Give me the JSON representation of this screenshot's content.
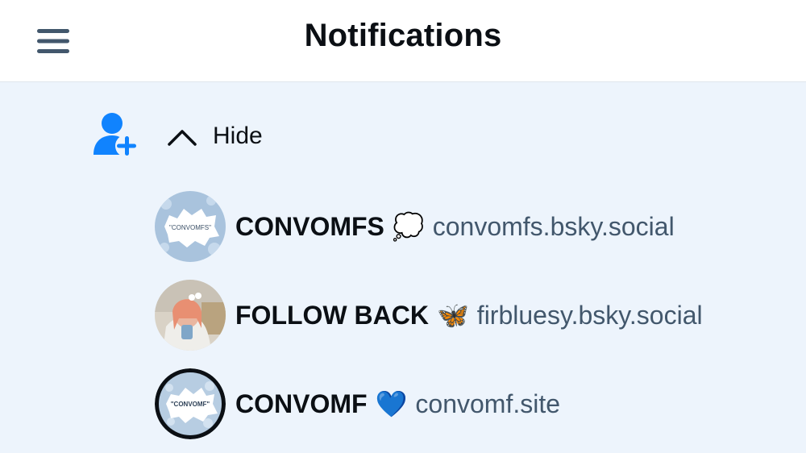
{
  "header": {
    "title": "Notifications",
    "menu_icon": "hamburger-menu-icon"
  },
  "notification": {
    "icon": "person-add-icon",
    "accent": "#1083fe",
    "toggle_label": "Hide",
    "users": [
      {
        "display_name": "CONVOMFS",
        "emoji": "💭",
        "handle": "convomfs.bsky.social",
        "avatar_text": "\"CONVOMFS\""
      },
      {
        "display_name": "FOLLOW BACK",
        "emoji": "🦋",
        "handle": "firbluesy.bsky.social",
        "avatar_text": ""
      },
      {
        "display_name": "CONVOMF",
        "emoji": "💙",
        "handle": "convomf.site",
        "avatar_text": "\"CONVOMF\""
      }
    ]
  }
}
